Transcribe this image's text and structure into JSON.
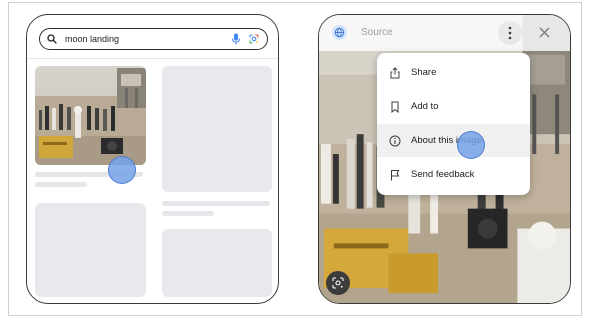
{
  "left_screen": {
    "search": {
      "query": "moon landing",
      "icons": [
        "search-icon",
        "mic-icon",
        "lens-icon"
      ]
    }
  },
  "right_screen": {
    "header": {
      "source_label": "Source",
      "icons": [
        "globe-icon",
        "more-vert-icon",
        "close-icon"
      ]
    },
    "menu": {
      "items": [
        {
          "label": "Share",
          "icon": "share-icon"
        },
        {
          "label": "Add to",
          "icon": "bookmark-icon"
        },
        {
          "label": "About this image",
          "icon": "info-icon",
          "highlighted": true
        },
        {
          "label": "Send feedback",
          "icon": "flag-icon"
        }
      ]
    },
    "fab_icon": "lens-icon"
  },
  "colors": {
    "tap_indicator": "#76a2e8",
    "placeholder": "#e9e9ed",
    "frame": "#3a3a3a"
  }
}
